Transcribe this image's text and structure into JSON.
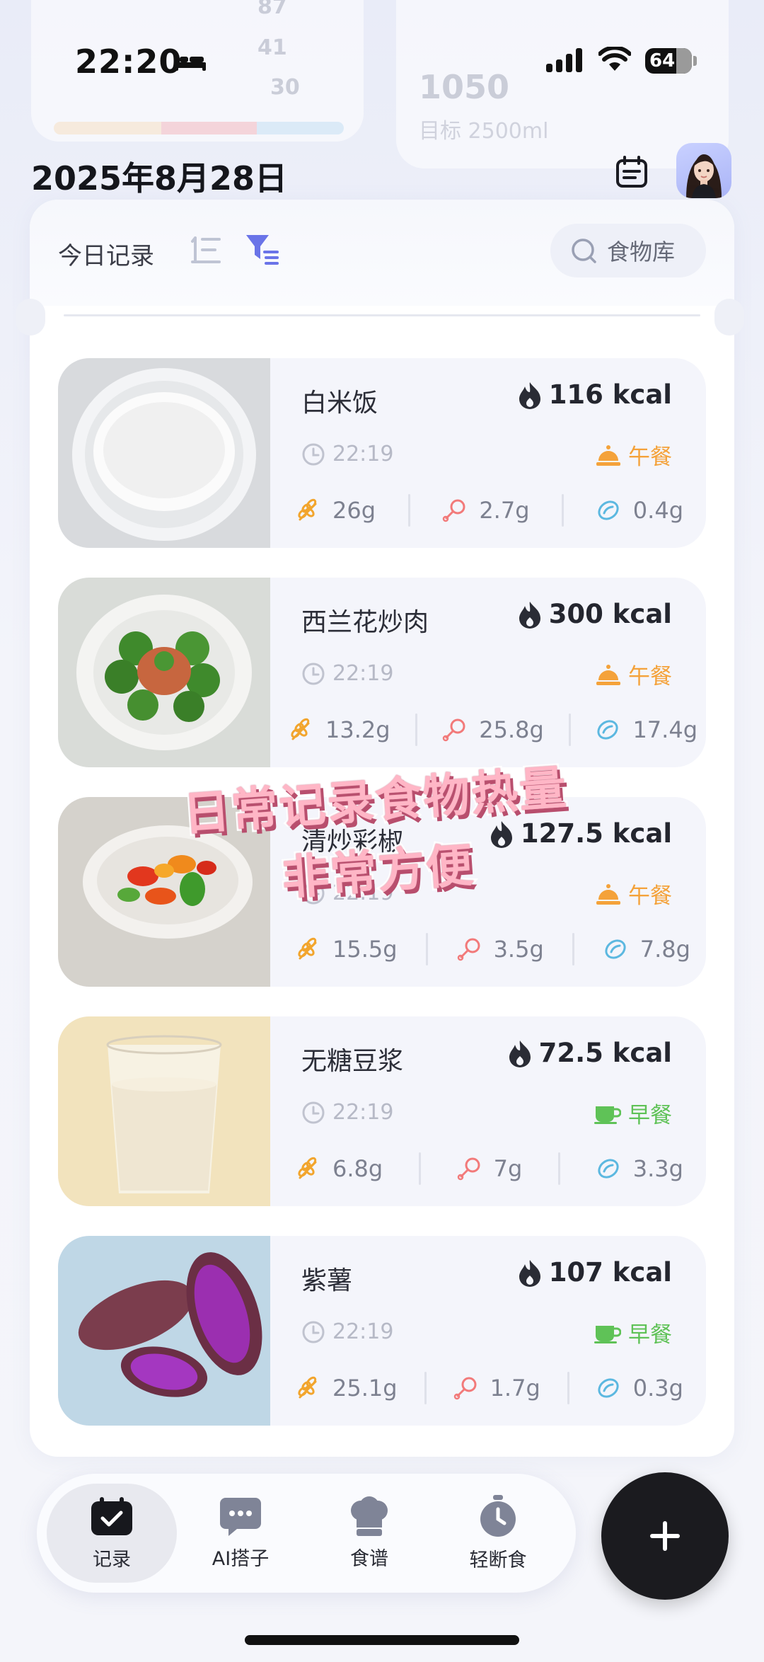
{
  "status_bar": {
    "time": "22:20",
    "battery": "64"
  },
  "header": {
    "date": "2025年8月28日"
  },
  "toolbar": {
    "today_label": "今日记录",
    "food_library": "食物库"
  },
  "foods": [
    {
      "name": "白米饭",
      "kcal": "116 kcal",
      "time": "22:19",
      "meal": "午餐",
      "meal_type": "lunch",
      "carb": "26g",
      "protein": "2.7g",
      "fat": "0.4g"
    },
    {
      "name": "西兰花炒肉",
      "kcal": "300 kcal",
      "time": "22:19",
      "meal": "午餐",
      "meal_type": "lunch",
      "carb": "13.2g",
      "protein": "25.8g",
      "fat": "17.4g"
    },
    {
      "name": "清炒彩椒",
      "kcal": "127.5 kcal",
      "time": "22:19",
      "meal": "午餐",
      "meal_type": "lunch",
      "carb": "15.5g",
      "protein": "3.5g",
      "fat": "7.8g"
    },
    {
      "name": "无糖豆浆",
      "kcal": "72.5 kcal",
      "time": "22:19",
      "meal": "早餐",
      "meal_type": "breakfast",
      "carb": "6.8g",
      "protein": "7g",
      "fat": "3.3g"
    },
    {
      "name": "紫薯",
      "kcal": "107 kcal",
      "time": "22:19",
      "meal": "早餐",
      "meal_type": "breakfast",
      "carb": "25.1g",
      "protein": "1.7g",
      "fat": "0.3g"
    }
  ],
  "overlay": {
    "line1": "日常记录食物热量",
    "line2": "非常方便"
  },
  "nav": [
    {
      "label": "记录",
      "icon": "calendar-check-icon",
      "active": true
    },
    {
      "label": "AI搭子",
      "icon": "chat-bubble-icon",
      "active": false
    },
    {
      "label": "食谱",
      "icon": "chef-hat-icon",
      "active": false
    },
    {
      "label": "轻断食",
      "icon": "stopwatch-icon",
      "active": false
    }
  ],
  "background_summary": {
    "values": [
      "87",
      "41",
      "30"
    ],
    "water": "1050",
    "water_target": "目标 2500ml"
  },
  "colors": {
    "lunch": "#f4a23a",
    "breakfast": "#5fc257",
    "carb": "#f2a52d",
    "protein": "#f27a7a",
    "fat": "#5cb8e0",
    "accent": "#6a74e8",
    "fab": "#1b1b1f"
  }
}
